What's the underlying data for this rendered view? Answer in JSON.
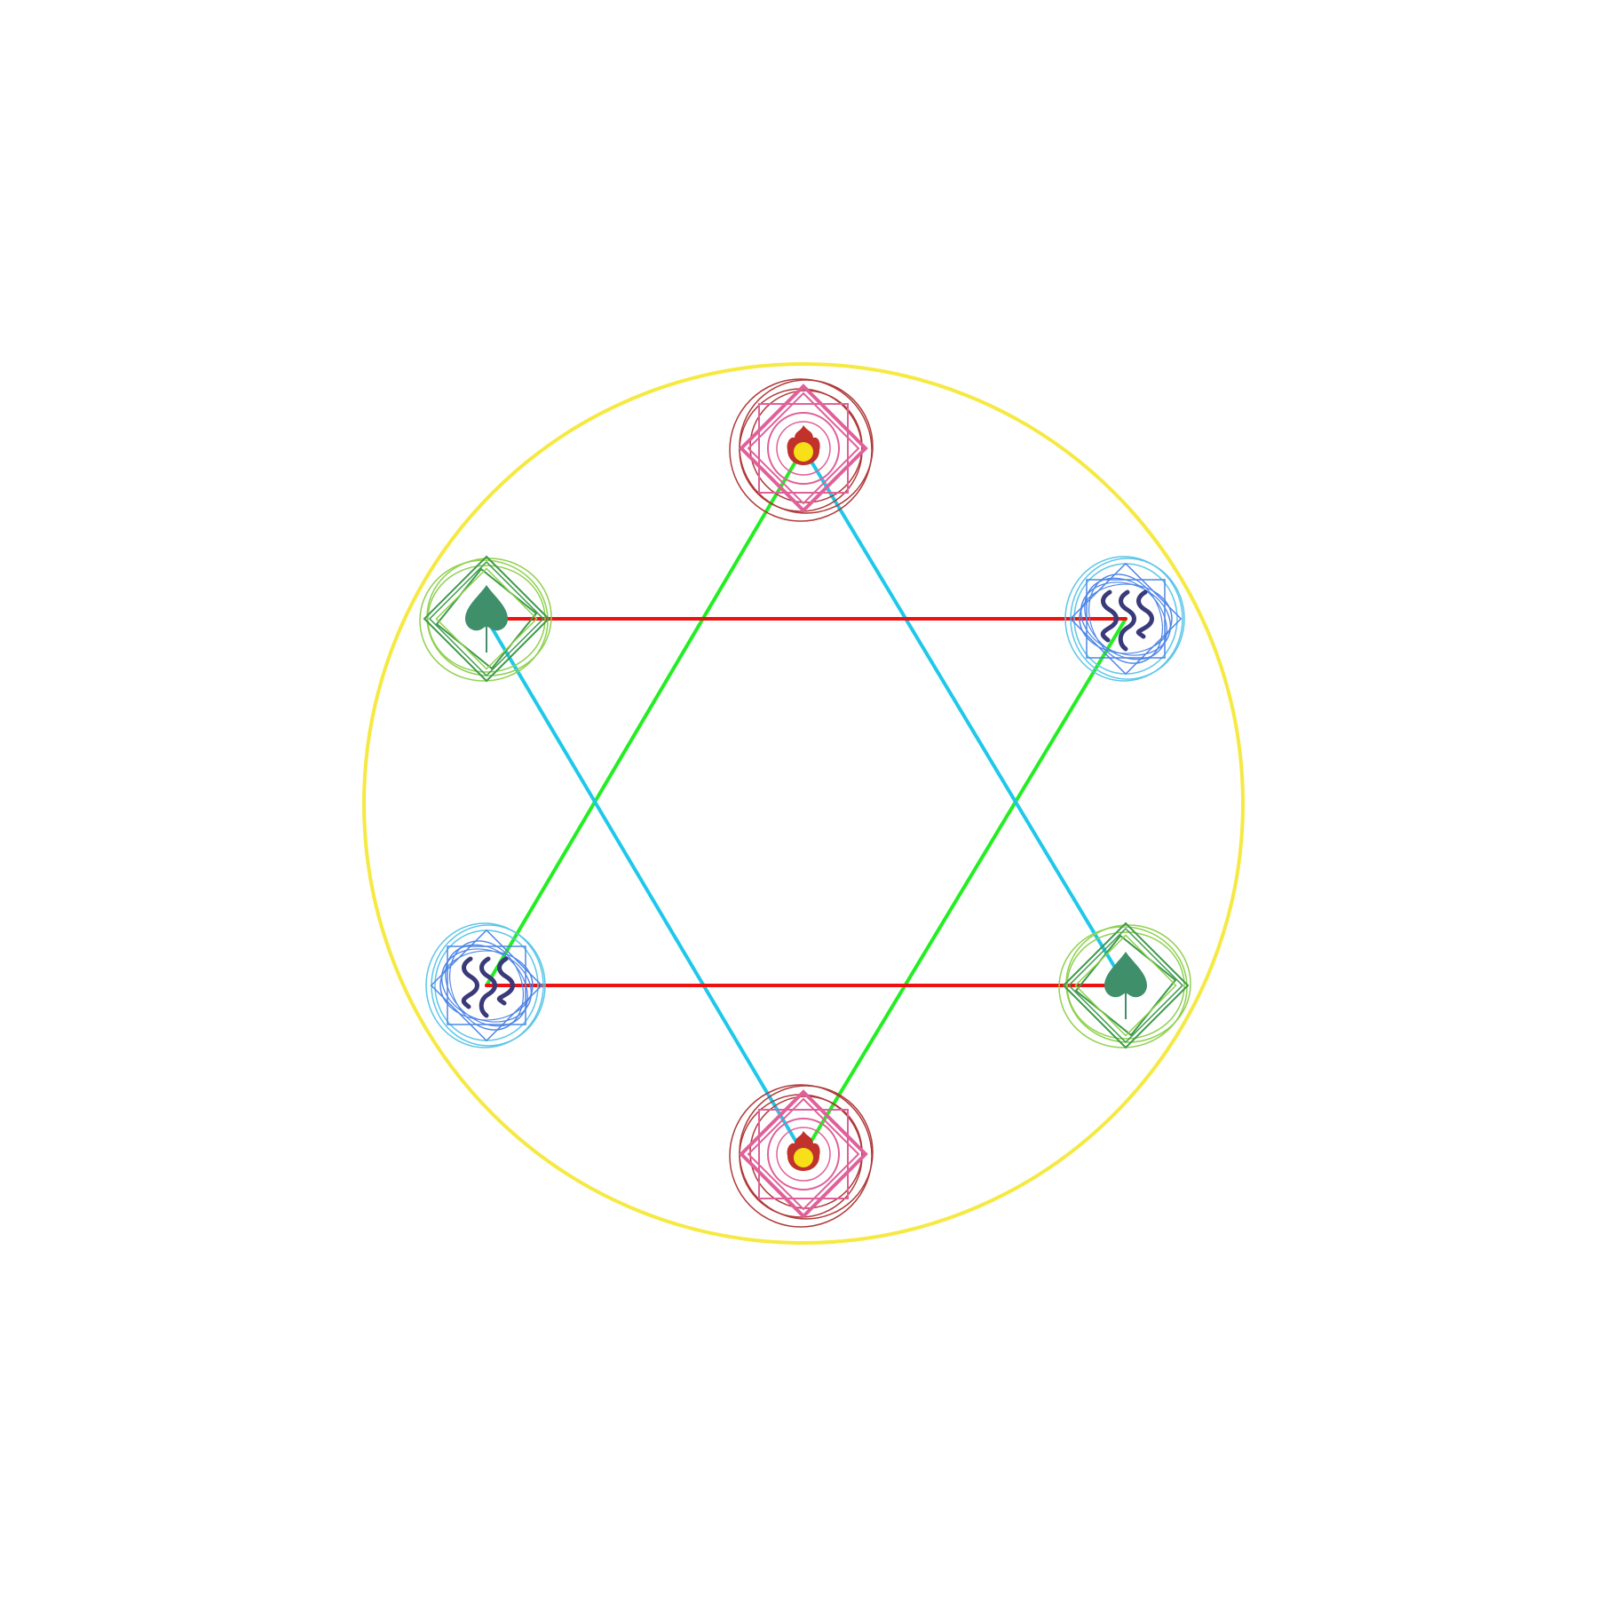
{
  "diagram": {
    "background": "#ffffff",
    "outer_ring_color": "#f5e942",
    "connections": [
      {
        "from": "fire-top",
        "to": "water-lower-left",
        "color": "#22ee22"
      },
      {
        "from": "fire-bottom",
        "to": "water-upper-right",
        "color": "#22ee22"
      },
      {
        "from": "fire-top",
        "to": "earth-lower-right",
        "color": "#1ec8ea"
      },
      {
        "from": "fire-bottom",
        "to": "earth-upper-left",
        "color": "#1ec8ea"
      },
      {
        "from": "earth-upper-left",
        "to": "water-upper-right",
        "color": "#ee1111"
      },
      {
        "from": "water-lower-left",
        "to": "earth-lower-right",
        "color": "#ee1111"
      }
    ],
    "nodes": [
      {
        "id": "fire-top",
        "element": "fire",
        "icon": "flame-icon",
        "colors": {
          "outer": "#b03a3a",
          "inner": "#e0609a",
          "core": "#f7e017",
          "flame": "#c0322b"
        }
      },
      {
        "id": "earth-upper-left",
        "element": "earth",
        "icon": "leaf-icon",
        "colors": {
          "outer": "#8fd14f",
          "inner": "#3c9a4a",
          "leaf": "#3f8f6a"
        }
      },
      {
        "id": "water-upper-right",
        "element": "water",
        "icon": "waves-icon",
        "colors": {
          "outer": "#5cc6e8",
          "inner": "#4f86e6",
          "glyph": "#3a3a7a"
        }
      },
      {
        "id": "water-lower-left",
        "element": "water",
        "icon": "waves-icon",
        "colors": {
          "outer": "#5cc6e8",
          "inner": "#4f86e6",
          "glyph": "#3a3a7a"
        }
      },
      {
        "id": "earth-lower-right",
        "element": "earth",
        "icon": "leaf-icon",
        "colors": {
          "outer": "#8fd14f",
          "inner": "#3c9a4a",
          "leaf": "#3f8f6a"
        }
      },
      {
        "id": "fire-bottom",
        "element": "fire",
        "icon": "flame-icon",
        "colors": {
          "outer": "#b03a3a",
          "inner": "#e0609a",
          "core": "#f7e017",
          "flame": "#c0322b"
        }
      }
    ]
  }
}
